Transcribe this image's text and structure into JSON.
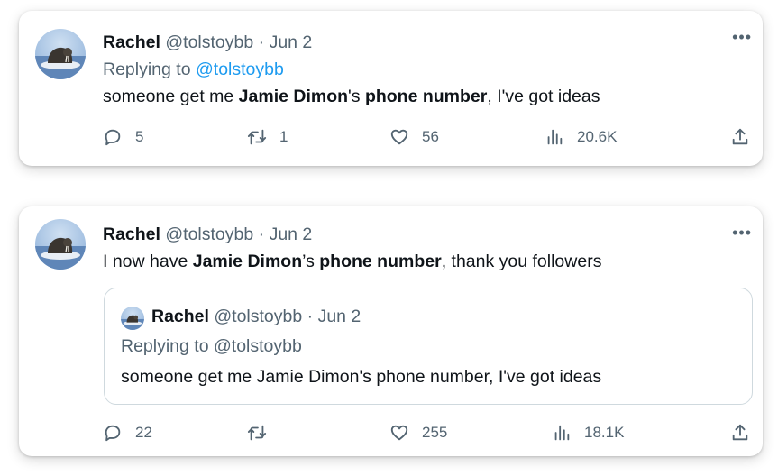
{
  "tweets": [
    {
      "author": {
        "name": "Rachel",
        "handle": "@tolstoybb"
      },
      "separator": "·",
      "date": "Jun 2",
      "replying_prefix": "Replying to",
      "replying_to": "@tolstoybb",
      "text_parts": [
        "someone get me ",
        "Jamie Dimon",
        "'s ",
        "phone number",
        ", I've got ideas"
      ],
      "more_icon": "ellipsis-icon",
      "metrics": {
        "replies": "5",
        "retweets": "1",
        "likes": "56",
        "views": "20.6K"
      }
    },
    {
      "author": {
        "name": "Rachel",
        "handle": "@tolstoybb"
      },
      "separator": "·",
      "date": "Jun 2",
      "text_parts": [
        "I now have ",
        "Jamie Dimon",
        "’s ",
        "phone number",
        ", thank you followers"
      ],
      "more_icon": "ellipsis-icon",
      "quote": {
        "author": {
          "name": "Rachel",
          "handle": "@tolstoybb"
        },
        "separator": "·",
        "date": "Jun 2",
        "replying": "Replying to @tolstoybb",
        "text": "someone get me Jamie Dimon's phone number, I've got ideas"
      },
      "metrics": {
        "replies": "22",
        "retweets": "",
        "likes": "255",
        "views": "18.1K"
      }
    }
  ],
  "colors": {
    "text": "#0f1419",
    "muted": "#536471",
    "link": "#1d9bf0",
    "border": "#cfd9de"
  },
  "icons": [
    "avatar-walrus",
    "ellipsis-icon",
    "reply-icon",
    "retweet-icon",
    "like-icon",
    "views-icon",
    "share-icon"
  ]
}
